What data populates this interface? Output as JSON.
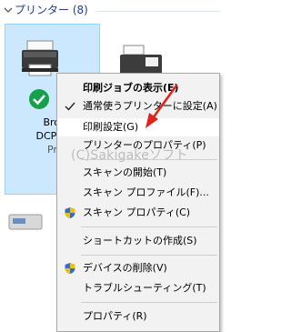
{
  "group": {
    "title": "プリンター (8)"
  },
  "printer": {
    "name_lines": [
      "Bro",
      "DCP-",
      "Pri"
    ]
  },
  "watermark": "(C)Sakigakeソフト",
  "menu": {
    "items": [
      {
        "label": "印刷ジョブの表示(E)",
        "bold": true,
        "lead": ""
      },
      {
        "label": "通常使うプリンターに設定(A)",
        "lead": "check-icon"
      },
      {
        "label": "印刷設定(G)",
        "lead": "",
        "highlighted": true
      },
      {
        "label": "プリンターのプロパティ(P)",
        "lead": ""
      },
      {
        "label": "スキャンの開始(T)",
        "lead": ""
      },
      {
        "label": "スキャン プロファイル(F)...",
        "lead": ""
      },
      {
        "label": "スキャン プロパティ(C)",
        "lead": "shield-icon"
      },
      {
        "label": "ショートカットの作成(S)",
        "lead": ""
      },
      {
        "label": "デバイスの削除(V)",
        "lead": "shield-icon"
      },
      {
        "label": "トラブルシューティング(T)",
        "lead": ""
      },
      {
        "label": "プロパティ(R)",
        "lead": ""
      }
    ]
  },
  "colors": {
    "header_text": "#1e3f8f",
    "tile_bg": "#cce8ff",
    "tile_border": "#99d1ff",
    "menu_bg": "#f2f2f2",
    "arrow": "#e0241b",
    "default_check": "#16a04a"
  }
}
